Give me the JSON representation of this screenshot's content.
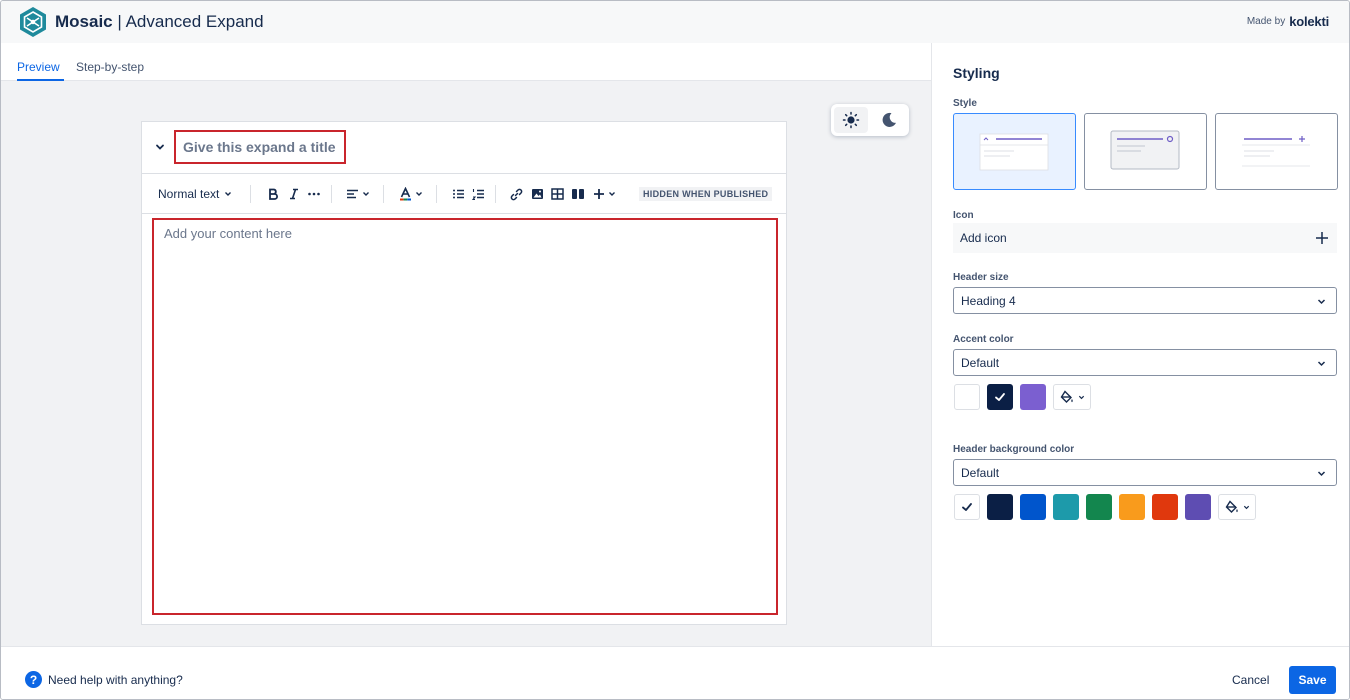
{
  "app": {
    "name": "Mosaic",
    "separator": " | ",
    "subtitle": "Advanced Expand",
    "made_by_label": "Made by",
    "made_by_brand": "kolekti"
  },
  "tabs": [
    {
      "label": "Preview",
      "active": true
    },
    {
      "label": "Step-by-step",
      "active": false
    }
  ],
  "theme_toggle": {
    "options": [
      "light-mode",
      "dark-mode"
    ],
    "active": "light-mode"
  },
  "editor": {
    "title_placeholder": "Give this expand a title",
    "toolbar": {
      "text_style": "Normal text",
      "hidden_badge": "HIDDEN WHEN PUBLISHED",
      "icons": [
        "bold-icon",
        "italic-icon",
        "more-formatting-icon",
        "align-icon",
        "text-color-icon",
        "bullet-list-icon",
        "numbered-list-icon",
        "link-icon",
        "image-icon",
        "table-icon",
        "layout-icon",
        "insert-icon"
      ]
    },
    "content_placeholder": "Add your content here"
  },
  "panel": {
    "title": "Styling",
    "style_label": "Style",
    "style_selected_index": 0,
    "icon_label": "Icon",
    "add_icon_label": "Add icon",
    "header_size_label": "Header size",
    "header_size_value": "Heading 4",
    "accent_color_label": "Accent color",
    "accent_color_value": "Default",
    "accent_swatches": [
      {
        "color": "#ffffff",
        "selected": false
      },
      {
        "color": "#0b1f45",
        "selected": true
      },
      {
        "color": "#7b5fd0",
        "selected": false
      }
    ],
    "header_bg_label": "Header background color",
    "header_bg_value": "Default",
    "header_bg_swatches": [
      {
        "color": "#ffffff",
        "selected": true
      },
      {
        "color": "#0b1f45",
        "selected": false
      },
      {
        "color": "#0055cc",
        "selected": false
      },
      {
        "color": "#1d9aaa",
        "selected": false
      },
      {
        "color": "#13864e",
        "selected": false
      },
      {
        "color": "#f99b1c",
        "selected": false
      },
      {
        "color": "#e0380d",
        "selected": false
      },
      {
        "color": "#5e4db2",
        "selected": false
      }
    ]
  },
  "footer": {
    "help_text": "Need help with anything?",
    "cancel_label": "Cancel",
    "save_label": "Save"
  },
  "colors": {
    "accent": "#0c66e4",
    "highlight_border": "#c9252c"
  }
}
